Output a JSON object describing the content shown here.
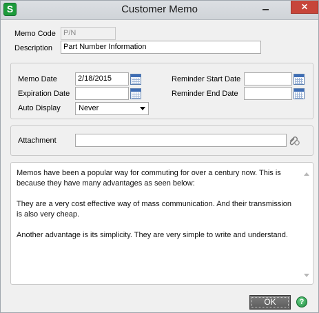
{
  "window": {
    "title": "Customer Memo",
    "app_icon_letter": "S",
    "close_glyph": "✕"
  },
  "header": {
    "memo_code_label": "Memo Code",
    "memo_code_value": "P/N",
    "description_label": "Description",
    "description_value": "Part Number Information"
  },
  "dates": {
    "memo_date_label": "Memo Date",
    "memo_date_value": "2/18/2015",
    "expiration_date_label": "Expiration Date",
    "expiration_date_value": "",
    "auto_display_label": "Auto Display",
    "auto_display_value": "Never",
    "reminder_start_label": "Reminder Start Date",
    "reminder_start_value": "",
    "reminder_end_label": "Reminder End Date",
    "reminder_end_value": ""
  },
  "attachment": {
    "label": "Attachment",
    "value": ""
  },
  "memo": {
    "paragraphs": [
      "Memos have been a popular way for commuting for over a century now. This is because they have many advantages as seen below:",
      "They are a very cost effective way of mass communication. And their transmission is also very cheap.",
      "Another advantage is its simplicity. They are very simple to write and understand."
    ]
  },
  "footer": {
    "ok_label": "OK",
    "help_glyph": "?"
  },
  "icons": {
    "app": "sage-s-icon",
    "calendar": "calendar-icon",
    "attachment": "paperclip-icon",
    "help": "help-icon"
  },
  "colors": {
    "close_button": "#c7453a",
    "app_icon": "#1d9b3b",
    "ok_button": "#6b6b6b",
    "help_icon": "#1e8a3e"
  }
}
